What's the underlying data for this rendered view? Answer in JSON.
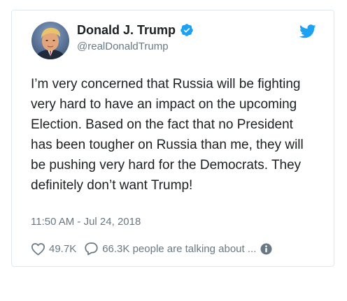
{
  "author": {
    "name": "Donald J. Trump",
    "handle": "@realDonaldTrump",
    "verified": true,
    "avatar_icon": "profile-photo"
  },
  "tweet": {
    "text": "I’m very concerned that Russia will be fighting very hard to have an impact on the upcoming Election. Based on the fact that no President has been tougher on Russia than me, they will be pushing very hard for the Democrats. They definitely don’t want Trump!",
    "timestamp": "11:50 AM - Jul 24, 2018"
  },
  "actions": {
    "like_count": "49.7K",
    "reply_text": "66.3K people are talking about ..."
  },
  "icons": {
    "brand": "twitter-bird-icon",
    "verified": "verified-badge-icon",
    "like": "heart-icon",
    "reply": "speech-bubble-icon",
    "info": "info-icon"
  },
  "colors": {
    "brand": "#1da1f2",
    "text": "#1c2022",
    "secondary_text": "#697882",
    "border": "#e1e8ed"
  }
}
